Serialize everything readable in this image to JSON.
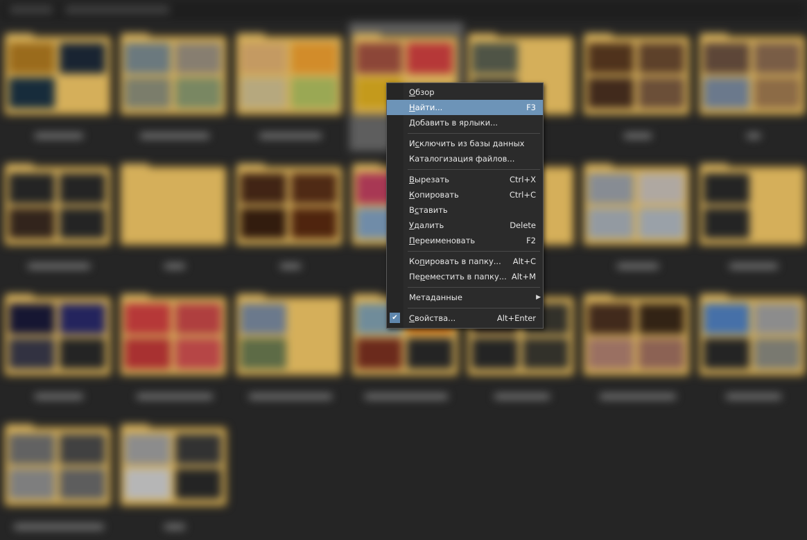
{
  "context_menu": {
    "items": [
      {
        "label": "Обзор",
        "shortcut": "",
        "mnemonic": 0
      },
      {
        "label": "Найти...",
        "shortcut": "F3",
        "mnemonic": 0,
        "highlighted": true
      },
      {
        "label": "Добавить в ярлыки...",
        "shortcut": "",
        "mnemonic": 0
      },
      {
        "separator": true
      },
      {
        "label": "Исключить из базы данных",
        "shortcut": "",
        "mnemonic": 1
      },
      {
        "label": "Каталогизация файлов...",
        "shortcut": "",
        "mnemonic": -1
      },
      {
        "separator": true
      },
      {
        "label": "Вырезать",
        "shortcut": "Ctrl+X",
        "mnemonic": 0
      },
      {
        "label": "Копировать",
        "shortcut": "Ctrl+C",
        "mnemonic": 0
      },
      {
        "label": "Вставить",
        "shortcut": "",
        "mnemonic": 1
      },
      {
        "label": "Удалить",
        "shortcut": "Delete",
        "mnemonic": 0
      },
      {
        "label": "Переименовать",
        "shortcut": "F2",
        "mnemonic": 0
      },
      {
        "separator": true
      },
      {
        "label": "Копировать в папку...",
        "shortcut": "Alt+C",
        "mnemonic": 2
      },
      {
        "label": "Переместить в папку...",
        "shortcut": "Alt+M",
        "mnemonic": 2
      },
      {
        "separator": true
      },
      {
        "label": "Метаданные",
        "shortcut": "",
        "mnemonic": -1,
        "submenu": true
      },
      {
        "separator": true
      },
      {
        "label": "Свойства...",
        "shortcut": "Alt+Enter",
        "mnemonic": 0,
        "checked": true
      }
    ]
  },
  "icons": {
    "submenu_arrow": "▶",
    "check": "✔"
  },
  "colors": {
    "background": "#2b2b2b",
    "menu_highlight": "#6d94b8",
    "folder_yellow": "#f3c867"
  }
}
